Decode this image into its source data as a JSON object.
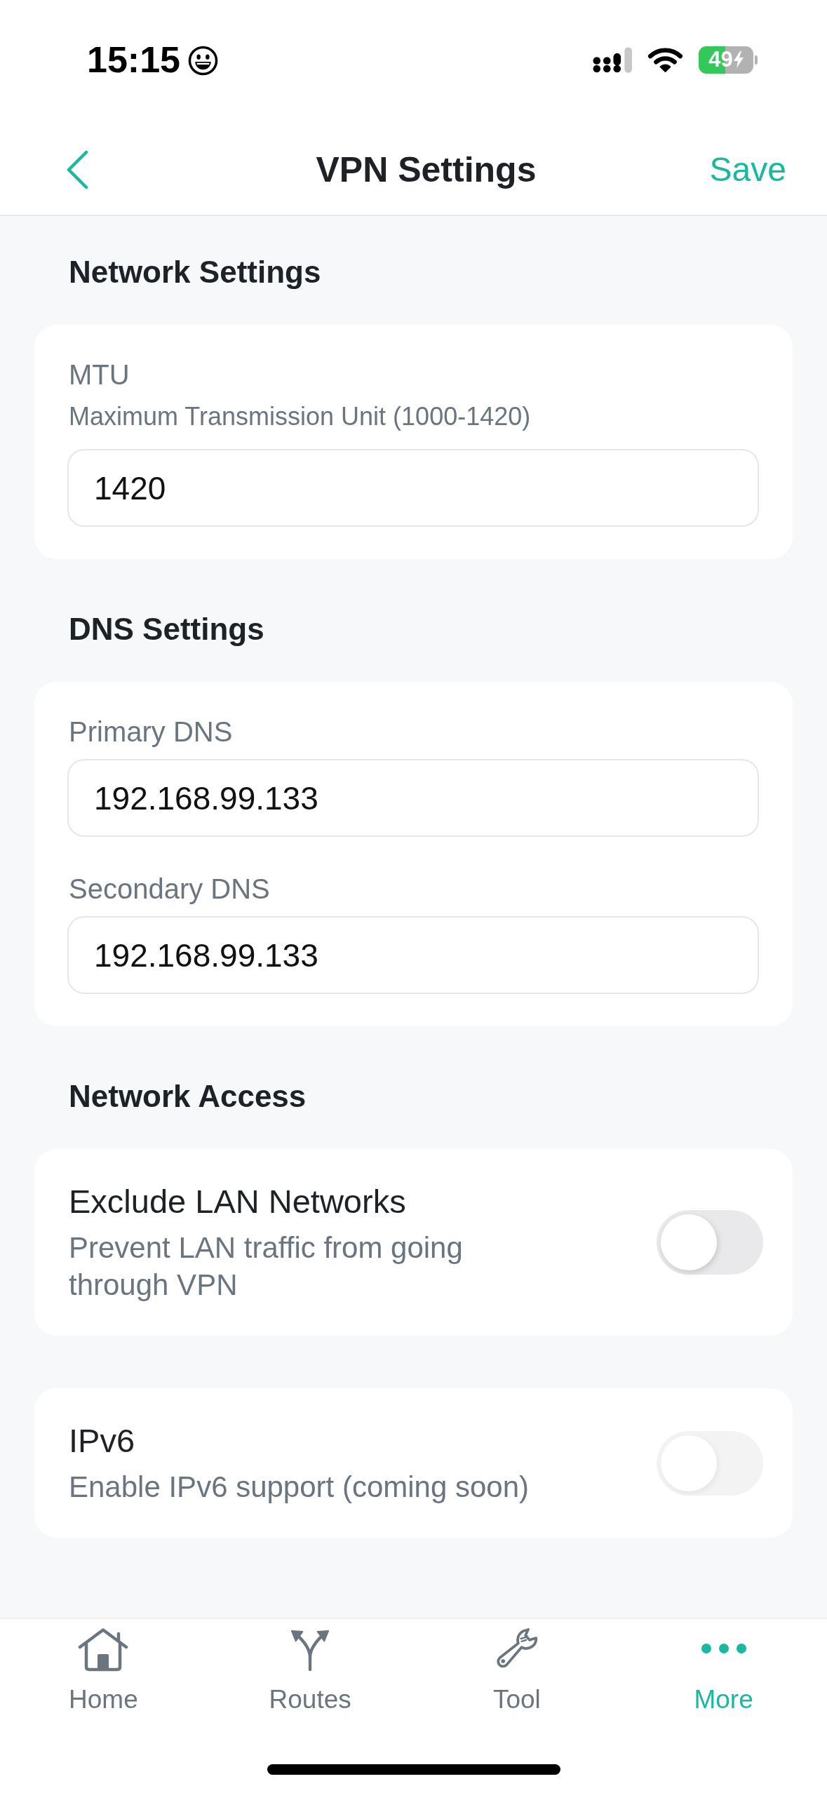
{
  "status_bar": {
    "time": "15:15",
    "battery": "49"
  },
  "nav_bar": {
    "title": "VPN Settings",
    "action": "Save"
  },
  "sections": [
    {
      "title": "Network Settings",
      "cards": [
        {
          "kind": "fields",
          "fields": [
            {
              "label": "MTU",
              "description": "Maximum Transmission Unit (1000-1420)",
              "value": "1420"
            }
          ]
        }
      ]
    },
    {
      "title": "DNS Settings",
      "cards": [
        {
          "kind": "fields",
          "fields": [
            {
              "label": "Primary DNS",
              "value": "192.168.99.133"
            },
            {
              "label": "Secondary DNS",
              "value": "192.168.99.133"
            }
          ]
        }
      ]
    },
    {
      "title": "Network Access",
      "cards": [
        {
          "kind": "toggle",
          "title": "Exclude LAN Networks",
          "description": "Prevent LAN traffic from going through VPN",
          "on": false,
          "disabled": false
        },
        {
          "kind": "toggle",
          "title": "IPv6",
          "description": "Enable IPv6 support (coming soon)",
          "on": false,
          "disabled": true
        }
      ]
    }
  ],
  "tab_bar": [
    {
      "label": "Home",
      "selected": false
    },
    {
      "label": "Routes",
      "selected": false
    },
    {
      "label": "Tool",
      "selected": false
    },
    {
      "label": "More",
      "selected": true
    }
  ]
}
